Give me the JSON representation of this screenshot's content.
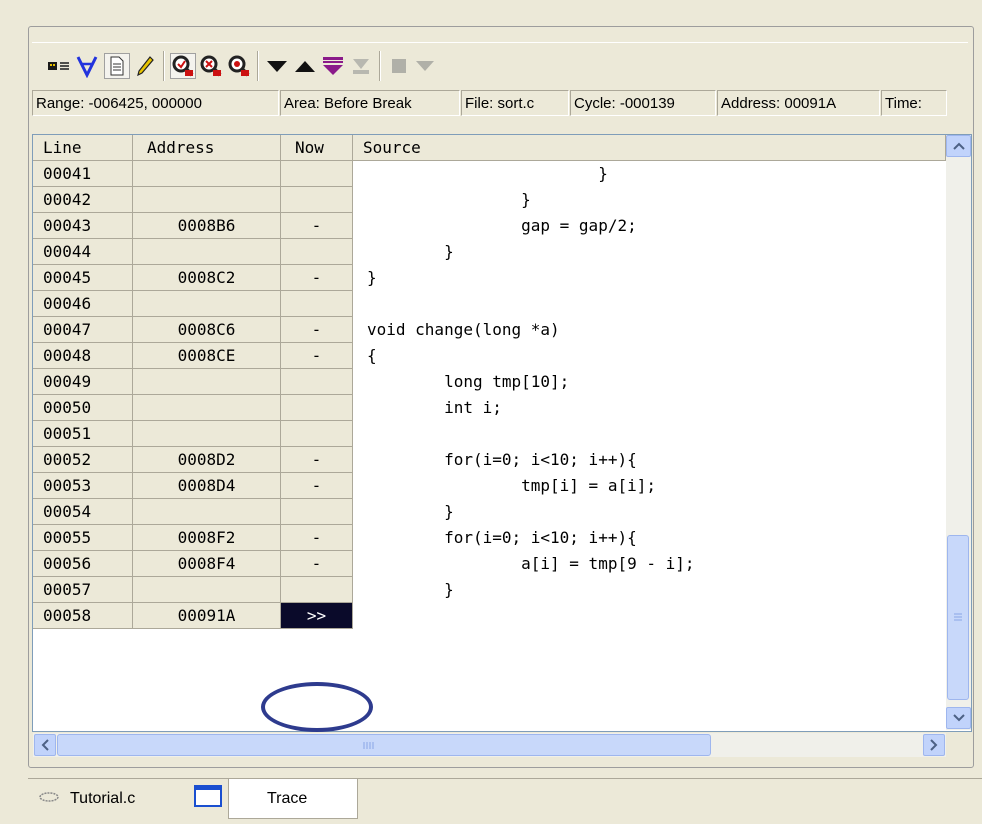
{
  "toolbar": {
    "buttons": [
      {
        "name": "trace-settings-icon"
      },
      {
        "name": "filter-icon"
      },
      {
        "name": "document-icon"
      },
      {
        "name": "edit-pencil-icon"
      },
      {
        "name": "acquire-trace-icon"
      },
      {
        "name": "stop-trace-icon"
      },
      {
        "name": "restart-trace-icon"
      },
      {
        "name": "step-down-icon"
      },
      {
        "name": "step-up-icon"
      },
      {
        "name": "step-down-to-end-icon"
      },
      {
        "name": "step-up-to-start-icon"
      },
      {
        "name": "stop-icon"
      },
      {
        "name": "dropdown-icon"
      }
    ]
  },
  "status": {
    "range": "Range: -006425, 000000",
    "area": "Area: Before Break",
    "file": "File: sort.c",
    "cycle": "Cycle: -000139",
    "address": "Address: 00091A",
    "time": "Time:"
  },
  "grid": {
    "headers": {
      "line": "Line",
      "address": "Address",
      "now": "Now",
      "source": "Source"
    },
    "rows": [
      {
        "line": "00041",
        "address": "",
        "now": "",
        "source": "                        }"
      },
      {
        "line": "00042",
        "address": "",
        "now": "",
        "source": "                }"
      },
      {
        "line": "00043",
        "address": "0008B6",
        "now": "-",
        "source": "                gap = gap/2;"
      },
      {
        "line": "00044",
        "address": "",
        "now": "",
        "source": "        }"
      },
      {
        "line": "00045",
        "address": "0008C2",
        "now": "-",
        "source": "}"
      },
      {
        "line": "00046",
        "address": "",
        "now": "",
        "source": ""
      },
      {
        "line": "00047",
        "address": "0008C6",
        "now": "-",
        "source": "void change(long *a)"
      },
      {
        "line": "00048",
        "address": "0008CE",
        "now": "-",
        "source": "{"
      },
      {
        "line": "00049",
        "address": "",
        "now": "",
        "source": "        long tmp[10];"
      },
      {
        "line": "00050",
        "address": "",
        "now": "",
        "source": "        int i;"
      },
      {
        "line": "00051",
        "address": "",
        "now": "",
        "source": ""
      },
      {
        "line": "00052",
        "address": "0008D2",
        "now": "-",
        "source": "        for(i=0; i<10; i++){"
      },
      {
        "line": "00053",
        "address": "0008D4",
        "now": "-",
        "source": "                tmp[i] = a[i];"
      },
      {
        "line": "00054",
        "address": "",
        "now": "",
        "source": "        }"
      },
      {
        "line": "00055",
        "address": "0008F2",
        "now": "-",
        "source": "        for(i=0; i<10; i++){"
      },
      {
        "line": "00056",
        "address": "0008F4",
        "now": "-",
        "source": "                a[i] = tmp[9 - i];"
      },
      {
        "line": "00057",
        "address": "",
        "now": "",
        "source": "        }"
      },
      {
        "line": "00058",
        "address": "00091A",
        "now": ">>",
        "source": ""
      }
    ]
  },
  "tabs": [
    {
      "label": "Tutorial.c",
      "icon": "source-file-icon",
      "active": false
    },
    {
      "label": "Trace",
      "icon": "window-icon",
      "active": true
    }
  ]
}
